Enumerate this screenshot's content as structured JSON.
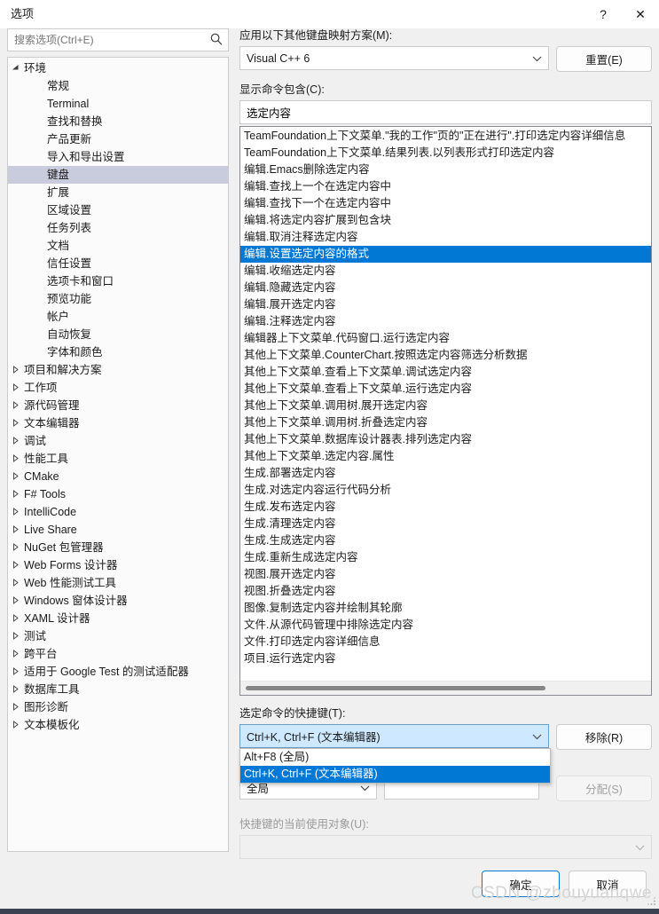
{
  "window": {
    "title": "选项",
    "help_glyph": "?",
    "close_glyph": "✕"
  },
  "search": {
    "placeholder": "搜索选项(Ctrl+E)",
    "value": ""
  },
  "tree": {
    "items": [
      {
        "label": "环境",
        "level": 0,
        "expanded": true,
        "selected": false
      },
      {
        "label": "常规",
        "level": 1,
        "expanded": false,
        "selected": false
      },
      {
        "label": "Terminal",
        "level": 1,
        "expanded": false,
        "selected": false
      },
      {
        "label": "查找和替换",
        "level": 1,
        "expanded": false,
        "selected": false
      },
      {
        "label": "产品更新",
        "level": 1,
        "expanded": false,
        "selected": false
      },
      {
        "label": "导入和导出设置",
        "level": 1,
        "expanded": false,
        "selected": false
      },
      {
        "label": "键盘",
        "level": 1,
        "expanded": false,
        "selected": true
      },
      {
        "label": "扩展",
        "level": 1,
        "expanded": false,
        "selected": false
      },
      {
        "label": "区域设置",
        "level": 1,
        "expanded": false,
        "selected": false
      },
      {
        "label": "任务列表",
        "level": 1,
        "expanded": false,
        "selected": false
      },
      {
        "label": "文档",
        "level": 1,
        "expanded": false,
        "selected": false
      },
      {
        "label": "信任设置",
        "level": 1,
        "expanded": false,
        "selected": false
      },
      {
        "label": "选项卡和窗口",
        "level": 1,
        "expanded": false,
        "selected": false
      },
      {
        "label": "预览功能",
        "level": 1,
        "expanded": false,
        "selected": false
      },
      {
        "label": "帐户",
        "level": 1,
        "expanded": false,
        "selected": false
      },
      {
        "label": "自动恢复",
        "level": 1,
        "expanded": false,
        "selected": false
      },
      {
        "label": "字体和颜色",
        "level": 1,
        "expanded": false,
        "selected": false
      },
      {
        "label": "项目和解决方案",
        "level": 0,
        "expanded": false,
        "selected": false
      },
      {
        "label": "工作项",
        "level": 0,
        "expanded": false,
        "selected": false
      },
      {
        "label": "源代码管理",
        "level": 0,
        "expanded": false,
        "selected": false
      },
      {
        "label": "文本编辑器",
        "level": 0,
        "expanded": false,
        "selected": false
      },
      {
        "label": "调试",
        "level": 0,
        "expanded": false,
        "selected": false
      },
      {
        "label": "性能工具",
        "level": 0,
        "expanded": false,
        "selected": false
      },
      {
        "label": "CMake",
        "level": 0,
        "expanded": false,
        "selected": false
      },
      {
        "label": "F# Tools",
        "level": 0,
        "expanded": false,
        "selected": false
      },
      {
        "label": "IntelliCode",
        "level": 0,
        "expanded": false,
        "selected": false
      },
      {
        "label": "Live Share",
        "level": 0,
        "expanded": false,
        "selected": false
      },
      {
        "label": "NuGet 包管理器",
        "level": 0,
        "expanded": false,
        "selected": false
      },
      {
        "label": "Web Forms 设计器",
        "level": 0,
        "expanded": false,
        "selected": false
      },
      {
        "label": "Web 性能测试工具",
        "level": 0,
        "expanded": false,
        "selected": false
      },
      {
        "label": "Windows 窗体设计器",
        "level": 0,
        "expanded": false,
        "selected": false
      },
      {
        "label": "XAML 设计器",
        "level": 0,
        "expanded": false,
        "selected": false
      },
      {
        "label": "测试",
        "level": 0,
        "expanded": false,
        "selected": false
      },
      {
        "label": "跨平台",
        "level": 0,
        "expanded": false,
        "selected": false
      },
      {
        "label": "适用于 Google Test 的测试适配器",
        "level": 0,
        "expanded": false,
        "selected": false
      },
      {
        "label": "数据库工具",
        "level": 0,
        "expanded": false,
        "selected": false
      },
      {
        "label": "图形诊断",
        "level": 0,
        "expanded": false,
        "selected": false
      },
      {
        "label": "文本模板化",
        "level": 0,
        "expanded": false,
        "selected": false
      }
    ]
  },
  "keyboard_page": {
    "scheme_label": "应用以下其他键盘映射方案(M):",
    "scheme_value": "Visual C++ 6",
    "reset_button": "重置(E)",
    "filter_label": "显示命令包含(C):",
    "filter_value": "选定内容",
    "commands": [
      "TeamFoundation上下文菜单.\"我的工作\"页的\"正在进行\".打印选定内容详细信息",
      "TeamFoundation上下文菜单.结果列表.以列表形式打印选定内容",
      "编辑.Emacs删除选定内容",
      "编辑.查找上一个在选定内容中",
      "编辑.查找下一个在选定内容中",
      "编辑.将选定内容扩展到包含块",
      "编辑.取消注释选定内容",
      "编辑.设置选定内容的格式",
      "编辑.收缩选定内容",
      "编辑.隐藏选定内容",
      "编辑.展开选定内容",
      "编辑.注释选定内容",
      "编辑器上下文菜单.代码窗口.运行选定内容",
      "其他上下文菜单.CounterChart.按照选定内容筛选分析数据",
      "其他上下文菜单.查看上下文菜单.调试选定内容",
      "其他上下文菜单.查看上下文菜单.运行选定内容",
      "其他上下文菜单.调用树.展开选定内容",
      "其他上下文菜单.调用树.折叠选定内容",
      "其他上下文菜单.数据库设计器表.排列选定内容",
      "其他上下文菜单.选定内容.属性",
      "生成.部署选定内容",
      "生成.对选定内容运行代码分析",
      "生成.发布选定内容",
      "生成.清理选定内容",
      "生成.生成选定内容",
      "生成.重新生成选定内容",
      "视图.展开选定内容",
      "视图.折叠选定内容",
      "图像.复制选定内容并绘制其轮廓",
      "文件.从源代码管理中排除选定内容",
      "文件.打印选定内容详细信息",
      "项目.运行选定内容"
    ],
    "selected_command_index": 7,
    "shortcut_label": "选定命令的快捷键(T):",
    "shortcut_value": "Ctrl+K, Ctrl+F (文本编辑器)",
    "shortcut_options": [
      "Alt+F8 (全局)",
      "Ctrl+K, Ctrl+F (文本编辑器)"
    ],
    "shortcut_selected_option_index": 1,
    "remove_button": "移除(R)",
    "scope_value": "全局",
    "press_keys_value": "",
    "assign_button": "分配(S)",
    "used_by_label": "快捷键的当前使用对象(U):",
    "used_by_value": ""
  },
  "footer": {
    "ok_button": "确定",
    "cancel_button": "取消",
    "watermark": "CSDN @zhouyuanqwe"
  },
  "colors": {
    "accent": "#0078d4",
    "tree_selection": "#c8ccdc",
    "combo_focus": "#cde8ff"
  }
}
